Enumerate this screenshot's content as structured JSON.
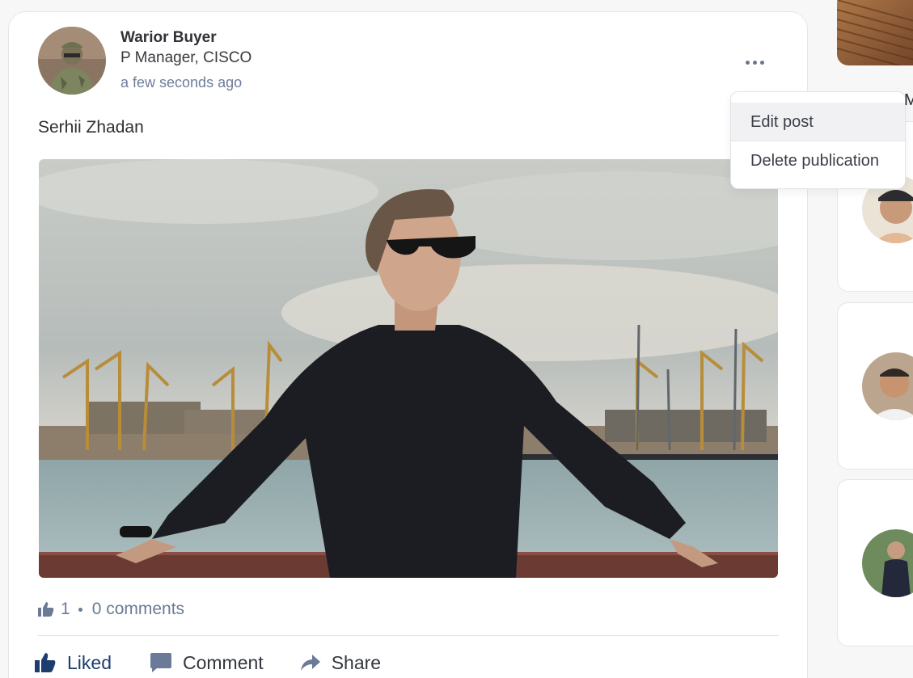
{
  "post": {
    "author_name": "Warior Buyer",
    "author_title": "P Manager, CISCO",
    "time": "a few seconds ago",
    "text": "Serhii Zhadan",
    "likes_count": "1",
    "comments_text": "0 comments"
  },
  "menu": {
    "edit_label": "Edit post",
    "delete_label": "Delete publication"
  },
  "sidebar": {
    "partial_label": "M"
  },
  "actions": {
    "like_label": "Liked",
    "comment_label": "Comment",
    "share_label": "Share"
  },
  "icons": {
    "more": "more-horizontal-icon",
    "like": "thumbs-up-icon",
    "comment": "comment-icon",
    "share": "share-arrow-icon"
  },
  "colors": {
    "accent": "#1c3d6e",
    "muted": "#6a7a97"
  }
}
